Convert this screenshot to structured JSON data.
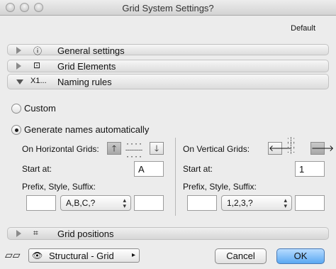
{
  "window": {
    "title": "Grid System Settings?"
  },
  "settings": {
    "default_label": "Default"
  },
  "sections": [
    {
      "label": "General settings",
      "icon": "info-icon",
      "state": "collapsed"
    },
    {
      "label": "Grid Elements",
      "icon": "grid-elements-icon",
      "state": "collapsed"
    },
    {
      "label": "Naming rules",
      "icon": "naming-icon",
      "state": "expanded",
      "icon_text": "X1..."
    },
    {
      "label": "Grid positions",
      "icon": "grid-positions-icon",
      "state": "collapsed"
    }
  ],
  "naming": {
    "custom_label": "Custom",
    "auto_label": "Generate names automatically",
    "selected": "auto",
    "horizontal": {
      "label": "On Horizontal Grids:",
      "start_label": "Start at:",
      "start_value": "A",
      "psf_label": "Prefix, Style, Suffix:",
      "prefix": "",
      "style": "A,B,C,?",
      "suffix": "",
      "direction": "up"
    },
    "vertical": {
      "label": "On Vertical Grids:",
      "start_label": "Start at:",
      "start_value": "1",
      "psf_label": "Prefix, Style, Suffix:",
      "prefix": "",
      "style": "1,2,3,?",
      "suffix": "",
      "direction": "right"
    }
  },
  "footer": {
    "layer": "Structural - Grid",
    "cancel": "Cancel",
    "ok": "OK"
  }
}
